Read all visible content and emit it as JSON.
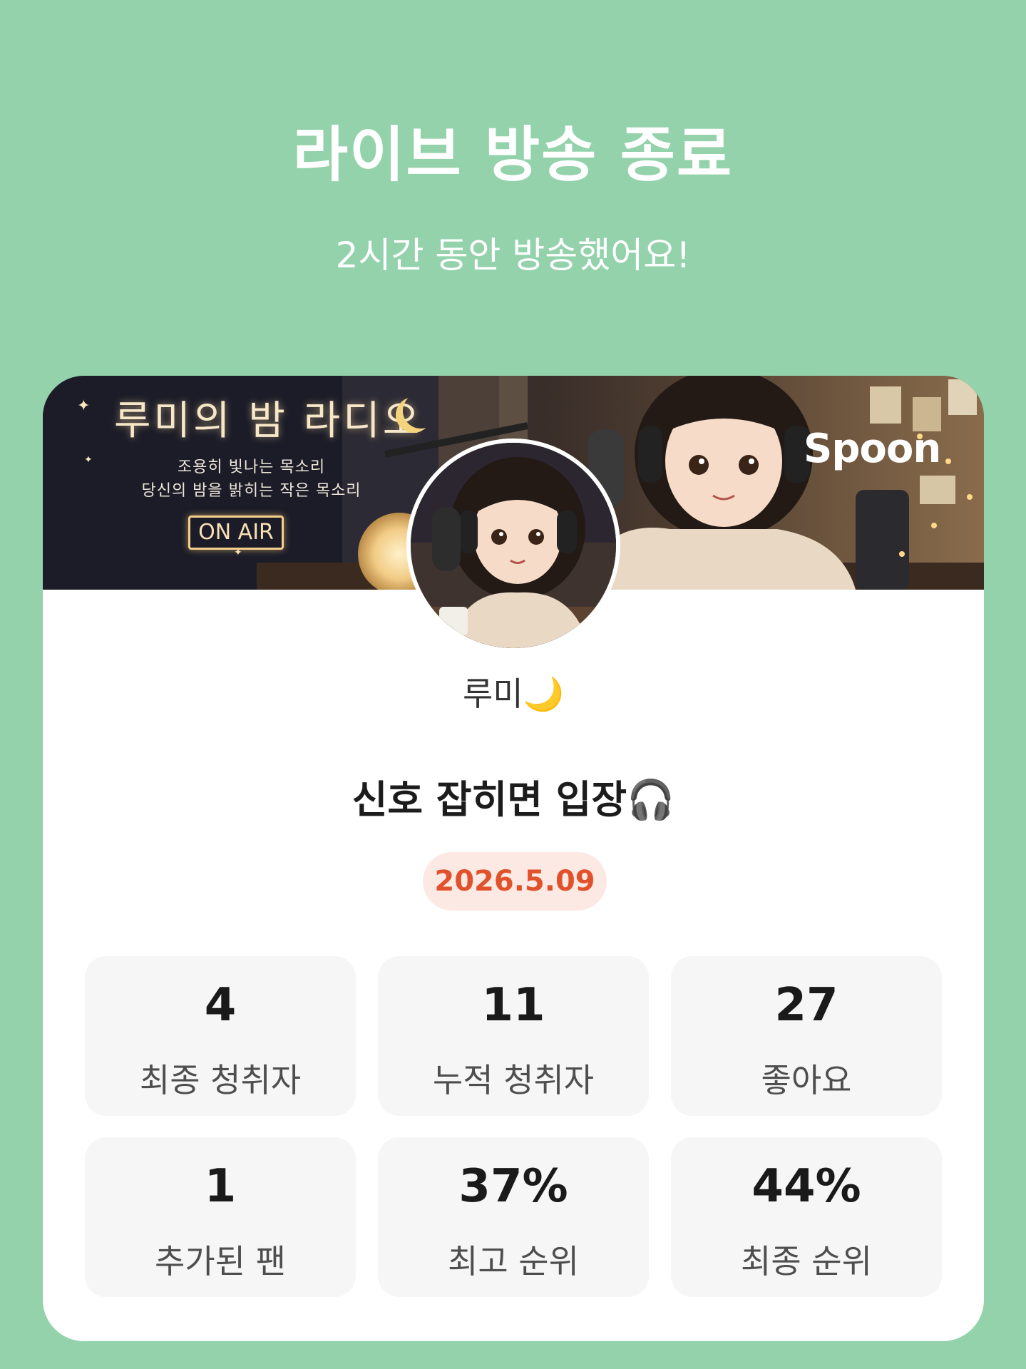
{
  "header": {
    "title": "라이브 방송 종료",
    "subtitle": "2시간 동안 방송했어요!"
  },
  "banner": {
    "title": "루미의 밤 라디오",
    "line1": "조용히 빛나는 목소리",
    "line2": "당신의 밤을 밝히는 작은 목소리",
    "onair": "ON AIR",
    "logo": "Spoon"
  },
  "profile": {
    "nickname": "루미🌙"
  },
  "live": {
    "title": "신호 잡히면 입장🎧",
    "date": "2026.5.09"
  },
  "stats": [
    {
      "value": "4",
      "label": "최종 청취자"
    },
    {
      "value": "11",
      "label": "누적 청취자"
    },
    {
      "value": "27",
      "label": "좋아요"
    },
    {
      "value": "1",
      "label": "추가된 팬"
    },
    {
      "value": "37%",
      "label": "최고 순위"
    },
    {
      "value": "44%",
      "label": "최종 순위"
    }
  ],
  "colors": {
    "background": "#93d2ab",
    "card": "#ffffff",
    "date_text": "#e1522c",
    "date_bg": "#fce9e3",
    "stat_bg": "#f6f6f6"
  }
}
